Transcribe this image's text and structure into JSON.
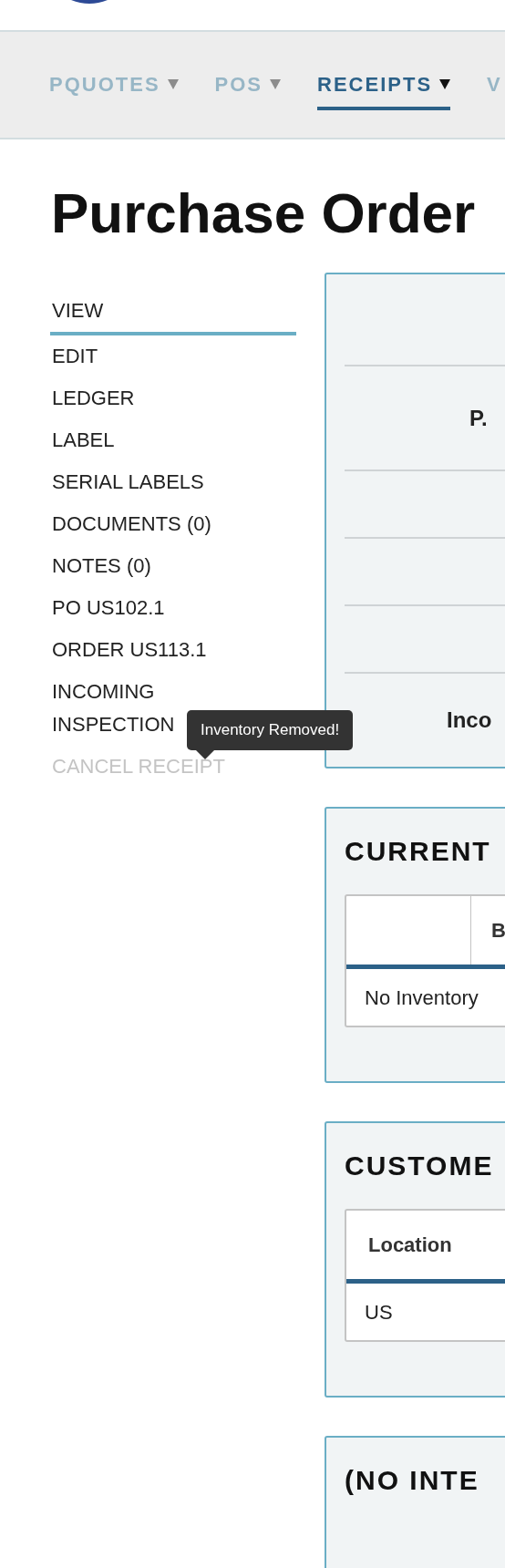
{
  "nav": [
    {
      "label": "PQUOTES",
      "selected": false,
      "dropdown": true
    },
    {
      "label": "POS",
      "selected": false,
      "dropdown": true
    },
    {
      "label": "RECEIPTS",
      "selected": true,
      "dropdown": true
    },
    {
      "label": "V",
      "selected": false,
      "dropdown": false
    }
  ],
  "title": "Purchase Order",
  "sidebar": [
    {
      "label": "VIEW",
      "selected": true,
      "disabled": false
    },
    {
      "label": "EDIT",
      "selected": false,
      "disabled": false
    },
    {
      "label": "LEDGER",
      "selected": false,
      "disabled": false
    },
    {
      "label": "LABEL",
      "selected": false,
      "disabled": false
    },
    {
      "label": "SERIAL LABELS",
      "selected": false,
      "disabled": false
    },
    {
      "label": "DOCUMENTS (0)",
      "selected": false,
      "disabled": false
    },
    {
      "label": "NOTES (0)",
      "selected": false,
      "disabled": false
    },
    {
      "label": "PO US102.1",
      "selected": false,
      "disabled": false
    },
    {
      "label": "ORDER US113.1",
      "selected": false,
      "disabled": false
    },
    {
      "label": "INCOMING INSPECTION",
      "selected": false,
      "disabled": false
    },
    {
      "label": "CANCEL RECEIPT",
      "selected": false,
      "disabled": true
    }
  ],
  "tooltip": "Inventory Removed!",
  "summary_panel": {
    "labels": [
      "P.",
      "Inco"
    ]
  },
  "panels": [
    {
      "title": "CURRENT",
      "columns": [
        {
          "kind": "blank"
        },
        {
          "kind": "text",
          "label": "B"
        }
      ],
      "rows": [
        [
          "No Inventory"
        ]
      ]
    },
    {
      "title": "CUSTOME",
      "columns": [
        {
          "kind": "text",
          "label": "Location"
        }
      ],
      "rows": [
        [
          "US"
        ]
      ]
    },
    {
      "title": "(NO INTE"
    }
  ]
}
